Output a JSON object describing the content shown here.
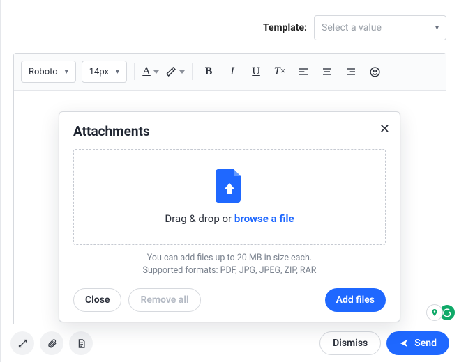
{
  "template": {
    "label": "Template:",
    "placeholder": "Select a value"
  },
  "toolbar": {
    "font_family": "Roboto",
    "font_size": "14px"
  },
  "bottom": {
    "dismiss": "Dismiss",
    "send": "Send"
  },
  "modal": {
    "title": "Attachments",
    "drop_prefix": "Drag & drop or ",
    "browse": "browse a file",
    "hint_line1": "You can add files up to 20 MB in size each.",
    "hint_line2": "Supported formats: PDF, JPG, JPEG, ZIP, RAR",
    "close": "Close",
    "remove_all": "Remove all",
    "add_files": "Add files"
  }
}
